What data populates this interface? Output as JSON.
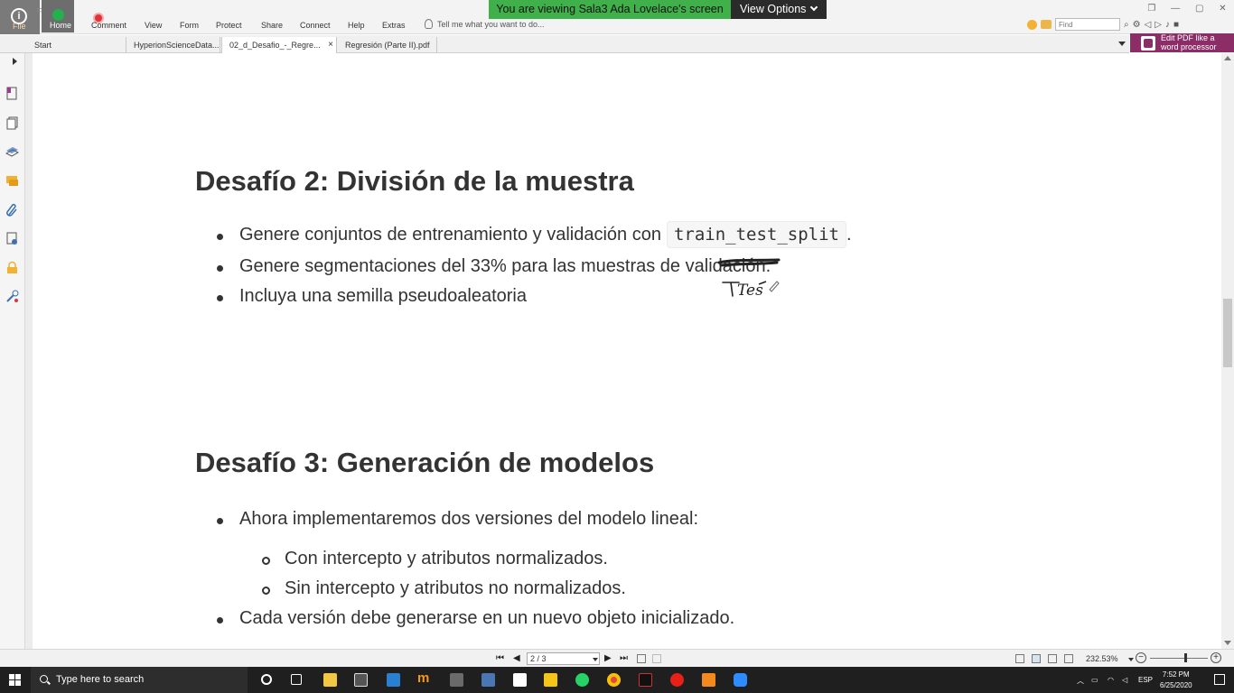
{
  "ribbon": {
    "file_label": "File",
    "quick_access_label": "Bookmarks",
    "menus": [
      "Home",
      "Comment",
      "View",
      "Form",
      "Protect",
      "Share",
      "Connect",
      "Help",
      "Extras"
    ],
    "tell_me": "Tell me what you want to do...",
    "find_placeholder": "Find"
  },
  "screen_share": {
    "message": "You are viewing Sala3 Ada Lovelace's screen",
    "view_options": "View Options"
  },
  "tabs": [
    {
      "label": "Start"
    },
    {
      "label": "HyperionScienceData..."
    },
    {
      "label": "02_d_Desafio_-_Regre..."
    },
    {
      "label": "Regresión (Parte II).pdf"
    }
  ],
  "tab_close": "×",
  "promo": {
    "line1": "Edit PDF like a",
    "line2": "word processor"
  },
  "document": {
    "heading1": "Desafío 2: División de la muestra",
    "items1": [
      {
        "text": "Genere conjuntos de entrenamiento y validación con",
        "code": "train_test_split",
        "after": "."
      },
      {
        "before": "Genere segmentaciones del 33% para las muestras de ",
        "struck": "validac",
        "after": "ión."
      },
      {
        "text": "Incluya una semilla pseudoaleatoria"
      }
    ],
    "handwritten": "Tes",
    "heading2": "Desafío 3: Generación de modelos",
    "items2": [
      "Ahora implementaremos dos versiones del modelo lineal:",
      "Con intercepto y atributos normalizados.",
      "Sin intercepto y atributos no normalizados.",
      "Cada versión debe generarse en un nuevo objeto inicializado."
    ]
  },
  "status": {
    "page": "2 / 3",
    "zoom": "232.53%"
  },
  "taskbar": {
    "search_placeholder": "Type here to search",
    "language": "ESP",
    "time": "7:52 PM",
    "date": "6/25/2020"
  },
  "colors": {
    "share_green": "#40b14a",
    "promo_purple": "#8d2d67",
    "text": "#333333"
  }
}
